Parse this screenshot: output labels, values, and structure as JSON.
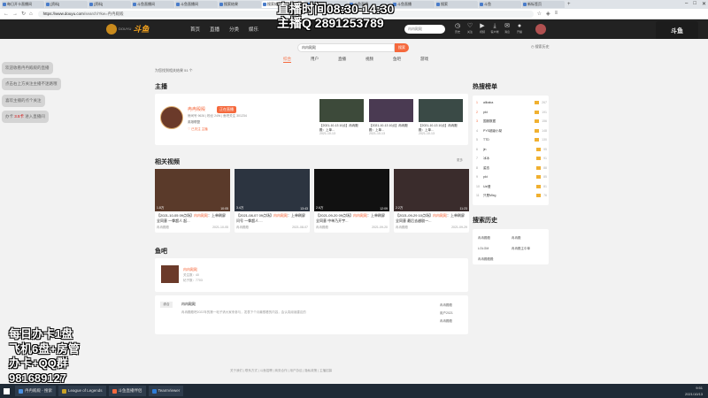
{
  "browser": {
    "tabs": [
      {
        "label": "每日开卡直播间",
        "active": false
      },
      {
        "label": "[资料]",
        "active": false
      },
      {
        "label": "[资料]",
        "active": false
      },
      {
        "label": "斗鱼直播间",
        "active": false
      },
      {
        "label": "斗鱼直播间",
        "active": false
      },
      {
        "label": "搜索结果",
        "active": false
      },
      {
        "label": "搜索结果",
        "active": true
      },
      {
        "label": "直播",
        "active": false
      },
      {
        "label": "斗鱼直播",
        "active": false
      },
      {
        "label": "斗鱼直播",
        "active": false
      },
      {
        "label": "搜索",
        "active": false
      },
      {
        "label": "斗鱼",
        "active": false
      },
      {
        "label": "新标签页",
        "active": false
      }
    ],
    "url_host": "https://www.douyu.com",
    "url_path": "/search/?kw=冉冉殿殿"
  },
  "overlay": {
    "line1": "直播时间08:30-14:30",
    "line2": "主播Q 2891253789",
    "corner_badge": "斗鱼",
    "promo": [
      "每日办卡1盘",
      "飞机6盘+房管",
      "办卡+QQ群",
      "981689127"
    ]
  },
  "header": {
    "logo_text": "DOUYU",
    "brand": "斗鱼",
    "nav": [
      "首页",
      "直播",
      "分类",
      "娱乐"
    ],
    "search_placeholder": "冉冉殿殿",
    "icons": [
      {
        "name": "history",
        "label": "历史"
      },
      {
        "name": "follow",
        "label": "关注"
      },
      {
        "name": "video",
        "label": "视频"
      },
      {
        "name": "download",
        "label": "客户端"
      },
      {
        "name": "message",
        "label": "消息"
      },
      {
        "name": "live",
        "label": "开播"
      }
    ]
  },
  "search": {
    "query": "冉冉殿殿",
    "button": "搜索",
    "history_link": "搜索历史",
    "tabs": [
      "综合",
      "用户",
      "直播",
      "视频",
      "鱼吧",
      "游戏"
    ],
    "result_tip": "为您找到相关结果 51 个"
  },
  "anchor": {
    "section": "主播",
    "name": "冉冉殿殿",
    "live_label": "正在直播",
    "meta": "房间号 9626 | 粉丝 24W | 鱼吧关注 301234",
    "game": "英雄联盟",
    "follow_label": "♡ 已关注 主播",
    "videos": [
      {
        "title": "【2021-10-13 10点】冉冉殿殿：上单…",
        "date": "2021-10-13"
      },
      {
        "title": "【2021-10-13 10点】冉冉殿殿：上单…",
        "date": "2021-10-13"
      },
      {
        "title": "【2021-10-13 10点】冉冉殿殿：上单…",
        "date": "2021-10-13"
      }
    ]
  },
  "videos": {
    "section": "相关视频",
    "more": "更多",
    "items": [
      {
        "title_prefix": "【2021-10-05 09点场】",
        "highlight": "冉冉殿殿",
        "title_suffix": "：上单刷屏 全同意 一拳超人 起...",
        "author": "冉冉殿殿",
        "date": "2021-10-05",
        "duration": "10:05",
        "views": "1.8万"
      },
      {
        "title_prefix": "【2021-08-07 09点场】",
        "highlight": "冉冉殿殿",
        "title_suffix": "：上单刷屏 问号 一拳超人 ...",
        "author": "冉冉殿殿",
        "date": "2021-08-07",
        "duration": "13:43",
        "views": "3.4万"
      },
      {
        "title_prefix": "【2021-09-20 09点场】",
        "highlight": "冉冉殿殿",
        "title_suffix": "：上单刷屏 全同意 中单乃开宇...",
        "author": "冉冉殿殿",
        "date": "2021-09-20",
        "duration": "12:09",
        "views": "2.6万"
      },
      {
        "title_prefix": "【2021-09-29 10点场】",
        "highlight": "冉冉殿殿",
        "title_suffix": "：上单刷屏 全同意 最后去越剧一...",
        "author": "冉冉殿殿",
        "date": "2021-09-29",
        "duration": "11:23",
        "views": "2.2万"
      }
    ]
  },
  "yuba": {
    "section": "鱼吧",
    "name": "冉冉殿殿",
    "m1": "关注数：40",
    "m2": "帖子数：7703"
  },
  "post": {
    "tag": "综合",
    "title": "冉冉殿殿",
    "body": "冉冉殿殿吧2022年的第一帖子请大家来参与，发表下个月最想看的内容，会认真阅读建议的",
    "side": [
      "冉冉殿殿",
      "用户2021",
      "冉冉殿殿"
    ]
  },
  "ranking": {
    "section": "热搜榜单",
    "items": [
      {
        "rank": "1",
        "name": "alibaba",
        "heat": "267"
      },
      {
        "rank": "2",
        "name": "pkt",
        "heat": "191"
      },
      {
        "rank": "3",
        "name": "国服数据",
        "heat": "156"
      },
      {
        "rank": "4",
        "name": "PYS超级小桀",
        "heat": "148"
      },
      {
        "rank": "5",
        "name": "TTD",
        "heat": "130"
      },
      {
        "rank": "6",
        "name": "jin",
        "heat": "95"
      },
      {
        "rank": "7",
        "name": "冰冰",
        "heat": "91"
      },
      {
        "rank": "8",
        "name": "姿态",
        "heat": "88"
      },
      {
        "rank": "9",
        "name": "pkt",
        "heat": "85"
      },
      {
        "rank": "10",
        "name": "Uzi爱",
        "heat": "81"
      },
      {
        "rank": "11",
        "name": "只是Mlxg",
        "heat": "76"
      }
    ]
  },
  "search_history": {
    "section": "搜索历史",
    "items": [
      "冉冉殿殿",
      "冉冉殿",
      "LOLGM",
      "冉冉殿主中单",
      "冉冉殿殿殿"
    ]
  },
  "chat_bubbles": [
    {
      "text": "欢迎收看冉冉殿殿的直播"
    },
    {
      "text": "点击右上方关注主播不迷路哦"
    },
    {
      "text": "喜欢主播的点个关注"
    },
    {
      "text": "办卡 ",
      "red": "3.5卡",
      "suffix": "  进入直播间"
    }
  ],
  "footer": "关于我们 | 联系方式 | 斗鱼招聘 | 商务合作 | 用户协议 | 隐私政策 | 主播招募",
  "taskbar": {
    "apps": [
      {
        "label": "冉冉殿殿 - 搜索",
        "color": "#4a90e2"
      },
      {
        "label": "League of Legends",
        "color": "#c9a227"
      },
      {
        "label": "斗鱼直播伴侣",
        "color": "#f5693d"
      },
      {
        "label": "TeamViewer",
        "color": "#2e7bd6"
      }
    ],
    "time": "9:51",
    "date": "2021/10/13"
  },
  "colors": {
    "accent": "#f5693d",
    "header_bg": "#222222",
    "page_bg": "#f2f2f2"
  }
}
